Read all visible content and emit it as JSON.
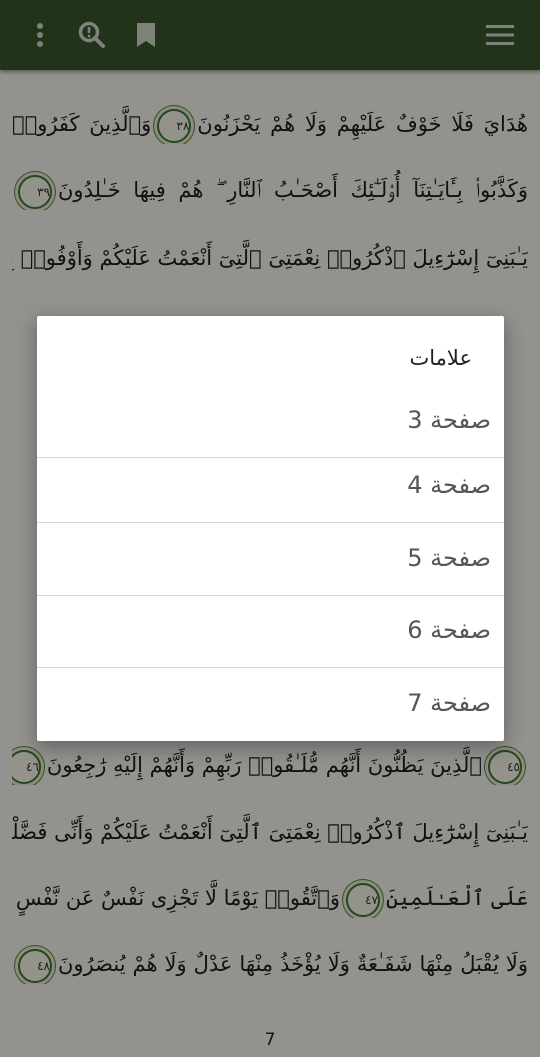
{
  "toolbar": {
    "overflow_icon": "more-vert-icon",
    "search_icon": "search-icon",
    "bookmark_icon": "bookmark-icon",
    "menu_icon": "hamburger-menu-icon",
    "color": "#3a5a2d"
  },
  "quran": {
    "lines": [
      "هُدَايَ فَلَا خَوْفٌ عَلَيْهِمْ وَلَا هُمْ يَحْزَنُونَ",
      "وَكَذَّبُوا۟ بِـَٔايَـٰتِنَآ أُو۟لَـٰٓئِكَ أَصْحَـٰبُ ٱلنَّارِ ۖ هُمْ فِيهَا خَـٰلِدُونَ",
      "يَـٰبَنِىٓ إِسْرَٰٓءِيلَ ٱذْكُرُوا۟ نِعْمَتِىَ ٱلَّتِىٓ أَنْعَمْتُ عَلَيْكُمْ وَأَوْفُوا۟ بِعَهْدِىٓ",
      "ٱلَّذِينَ يَظُنُّونَ أَنَّهُم مُّلَـٰقُوا۟ رَبِّهِمْ وَأَنَّهُمْ إِلَيْهِ رَٰجِعُونَ",
      "يَـٰبَنِىٓ إِسْرَٰٓءِيلَ ٱذْكُرُوا۟ نِعْمَتِىَ ٱلَّتِىٓ أَنْعَمْتُ عَلَيْكُمْ وَأَنِّى فَضَّلْتُكُمْ",
      "عَلَى ٱلْعَـٰلَمِينَ",
      "وَٱتَّقُوا۟ يَوْمًا لَّا تَجْزِى نَفْسٌ عَن نَّفْسٍ شَيْـًٔا",
      "وَلَا يُقْبَلُ مِنْهَا شَفَـٰعَةٌ وَلَا يُؤْخَذُ مِنْهَا عَدْلٌ وَلَا هُمْ يُنصَرُونَ"
    ],
    "ayah_38": "٣٨",
    "ayah_39": "٣٩",
    "ayah_45": "٤٥",
    "ayah_46": "٤٦",
    "ayah_47": "٤٧",
    "ayah_48": "٤٨",
    "tail_38": "وَٱلَّذِينَ كَفَرُوا۟",
    "page_number": "7"
  },
  "dialog": {
    "title": "علامات",
    "items": [
      {
        "label": "صفحة 3"
      },
      {
        "label": "صفحة 4"
      },
      {
        "label": "صفحة 5"
      },
      {
        "label": "صفحة 6"
      },
      {
        "label": "صفحة 7"
      }
    ]
  }
}
